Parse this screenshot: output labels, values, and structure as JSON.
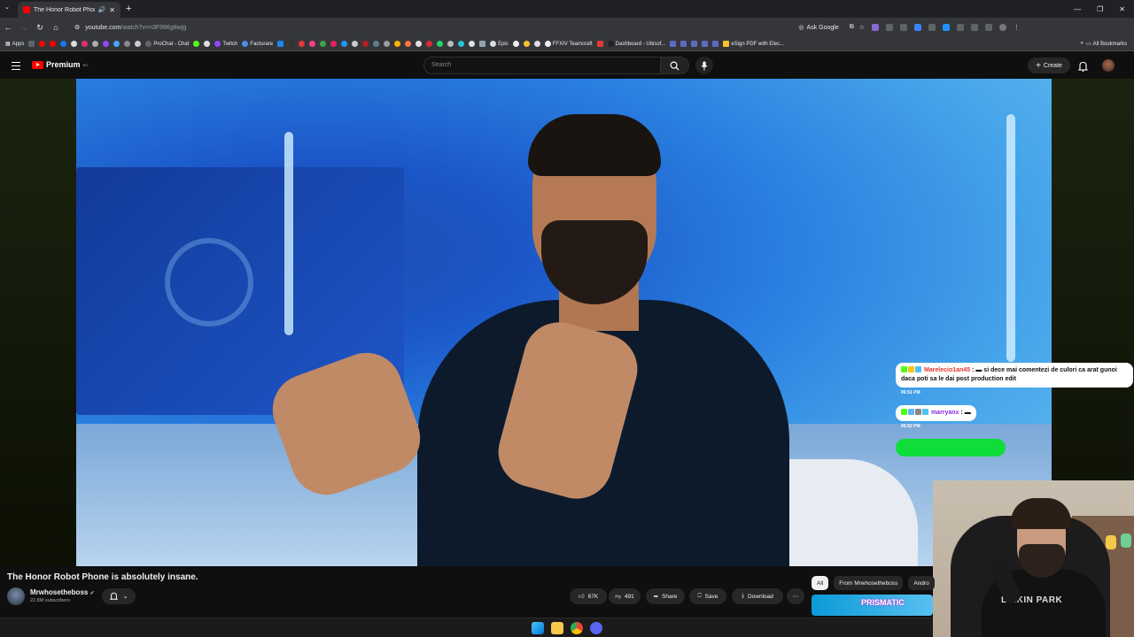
{
  "browser": {
    "tab_title": "The Honor Robot Phone is",
    "url_host": "youtube.com",
    "url_path": "/watch?v=n3F996g8wjg",
    "ask_google": "Ask Google",
    "apps_label": "Apps",
    "all_bookmarks": "All Bookmarks",
    "bookmarks": [
      "ProChat - Chat",
      "Twitch",
      "Facturare",
      "Epic",
      "FFXIV Teamcraft",
      "Dashboard - Ubisof...",
      "eSign PDF with Elec..."
    ]
  },
  "youtube": {
    "logo_text": "Premium",
    "logo_sup": "RO",
    "search_placeholder": "Search",
    "create_label": "Create"
  },
  "video": {
    "title": "The Honor Robot Phone is absolutely insane.",
    "channel": "Mrwhosetheboss",
    "subscribers": "22.8M subscribers",
    "likes": "67K",
    "dislikes": "491",
    "share": "Share",
    "save": "Save",
    "download": "Download"
  },
  "chips": [
    "All",
    "From Mrwhosetheboss",
    "Andro"
  ],
  "thumbnail_text": "PRISMATIC",
  "chat": [
    {
      "user": "Marelecio1an45",
      "message": "si dece mai comentezi de culori ca arat gunoi daca poti sa le dai post production edit",
      "time": "06:51 PM"
    },
    {
      "user": "marryanx",
      "message": "",
      "time": "06:52 PM"
    }
  ],
  "webcam": {
    "shirt_text": "LINKIN PARK"
  },
  "colors": {
    "accent": "#ff0000",
    "chat_bar": "#0fdd3a"
  }
}
